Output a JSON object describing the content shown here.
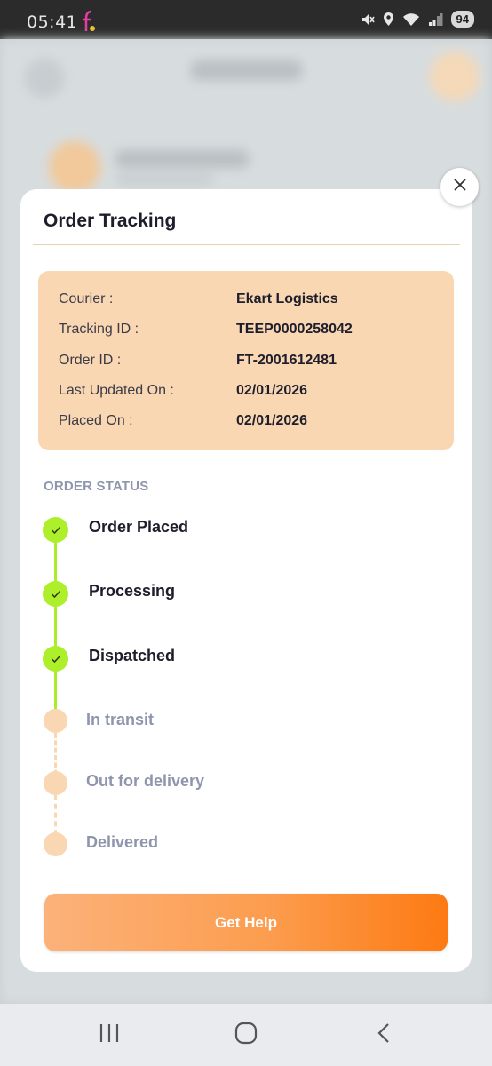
{
  "status_bar": {
    "time": "05:41",
    "battery": "94"
  },
  "modal": {
    "title": "Order Tracking",
    "details": [
      {
        "label": "Courier :",
        "value": "Ekart Logistics"
      },
      {
        "label": "Tracking ID :",
        "value": "TEEP0000258042"
      },
      {
        "label": "Order ID :",
        "value": "FT-2001612481"
      },
      {
        "label": "Last Updated On :",
        "value": "02/01/2026"
      },
      {
        "label": "Placed On :",
        "value": "02/01/2026"
      }
    ],
    "status_heading": "ORDER STATUS",
    "steps": [
      {
        "label": "Order Placed",
        "completed": true
      },
      {
        "label": "Processing",
        "completed": true
      },
      {
        "label": "Dispatched",
        "completed": true
      },
      {
        "label": "In transit",
        "completed": false
      },
      {
        "label": "Out for delivery",
        "completed": false
      },
      {
        "label": "Delivered",
        "completed": false
      }
    ],
    "help_button": "Get Help"
  },
  "colors": {
    "accent_green": "#aeef2c",
    "card_peach": "#f9d7b2",
    "button_orange": "#fd7a12",
    "muted_text": "#8e95ad"
  }
}
